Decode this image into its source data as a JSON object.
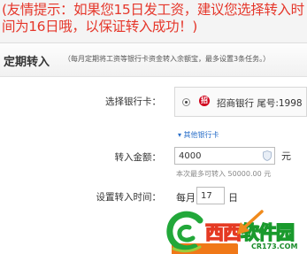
{
  "tip": {
    "text": "(友情提示：如果您15日发工资，建议您选择转入时间为16日哦，以保证转入成功！)"
  },
  "header": {
    "title": "定期转入",
    "subtitle": "（每月定期将工资等银行卡资金转入余额宝，最多设置3条任务。）"
  },
  "form": {
    "bank": {
      "label": "选择银行卡：",
      "logo_glyph": "招",
      "selected_bank": "招商银行 尾号:1998",
      "other_link": "▾ 其他银行卡"
    },
    "amount": {
      "label": "转入金额：",
      "value": "4000",
      "unit": "元",
      "hint": "本次最多可转入 50000.00 元"
    },
    "time": {
      "label": "设置转入时间：",
      "month_prefix": "每月",
      "day_value": "17",
      "day_unit": "日"
    }
  },
  "watermark": {
    "brand_cn_1": "西西",
    "brand_cn_2": "软件园",
    "domain": "CR173.COM"
  },
  "colors": {
    "tip_text": "#e5372b",
    "link": "#2a6fc9",
    "submit": "#f07818",
    "arrow": "#f08a1c",
    "bank_logo": "#d0021b"
  }
}
